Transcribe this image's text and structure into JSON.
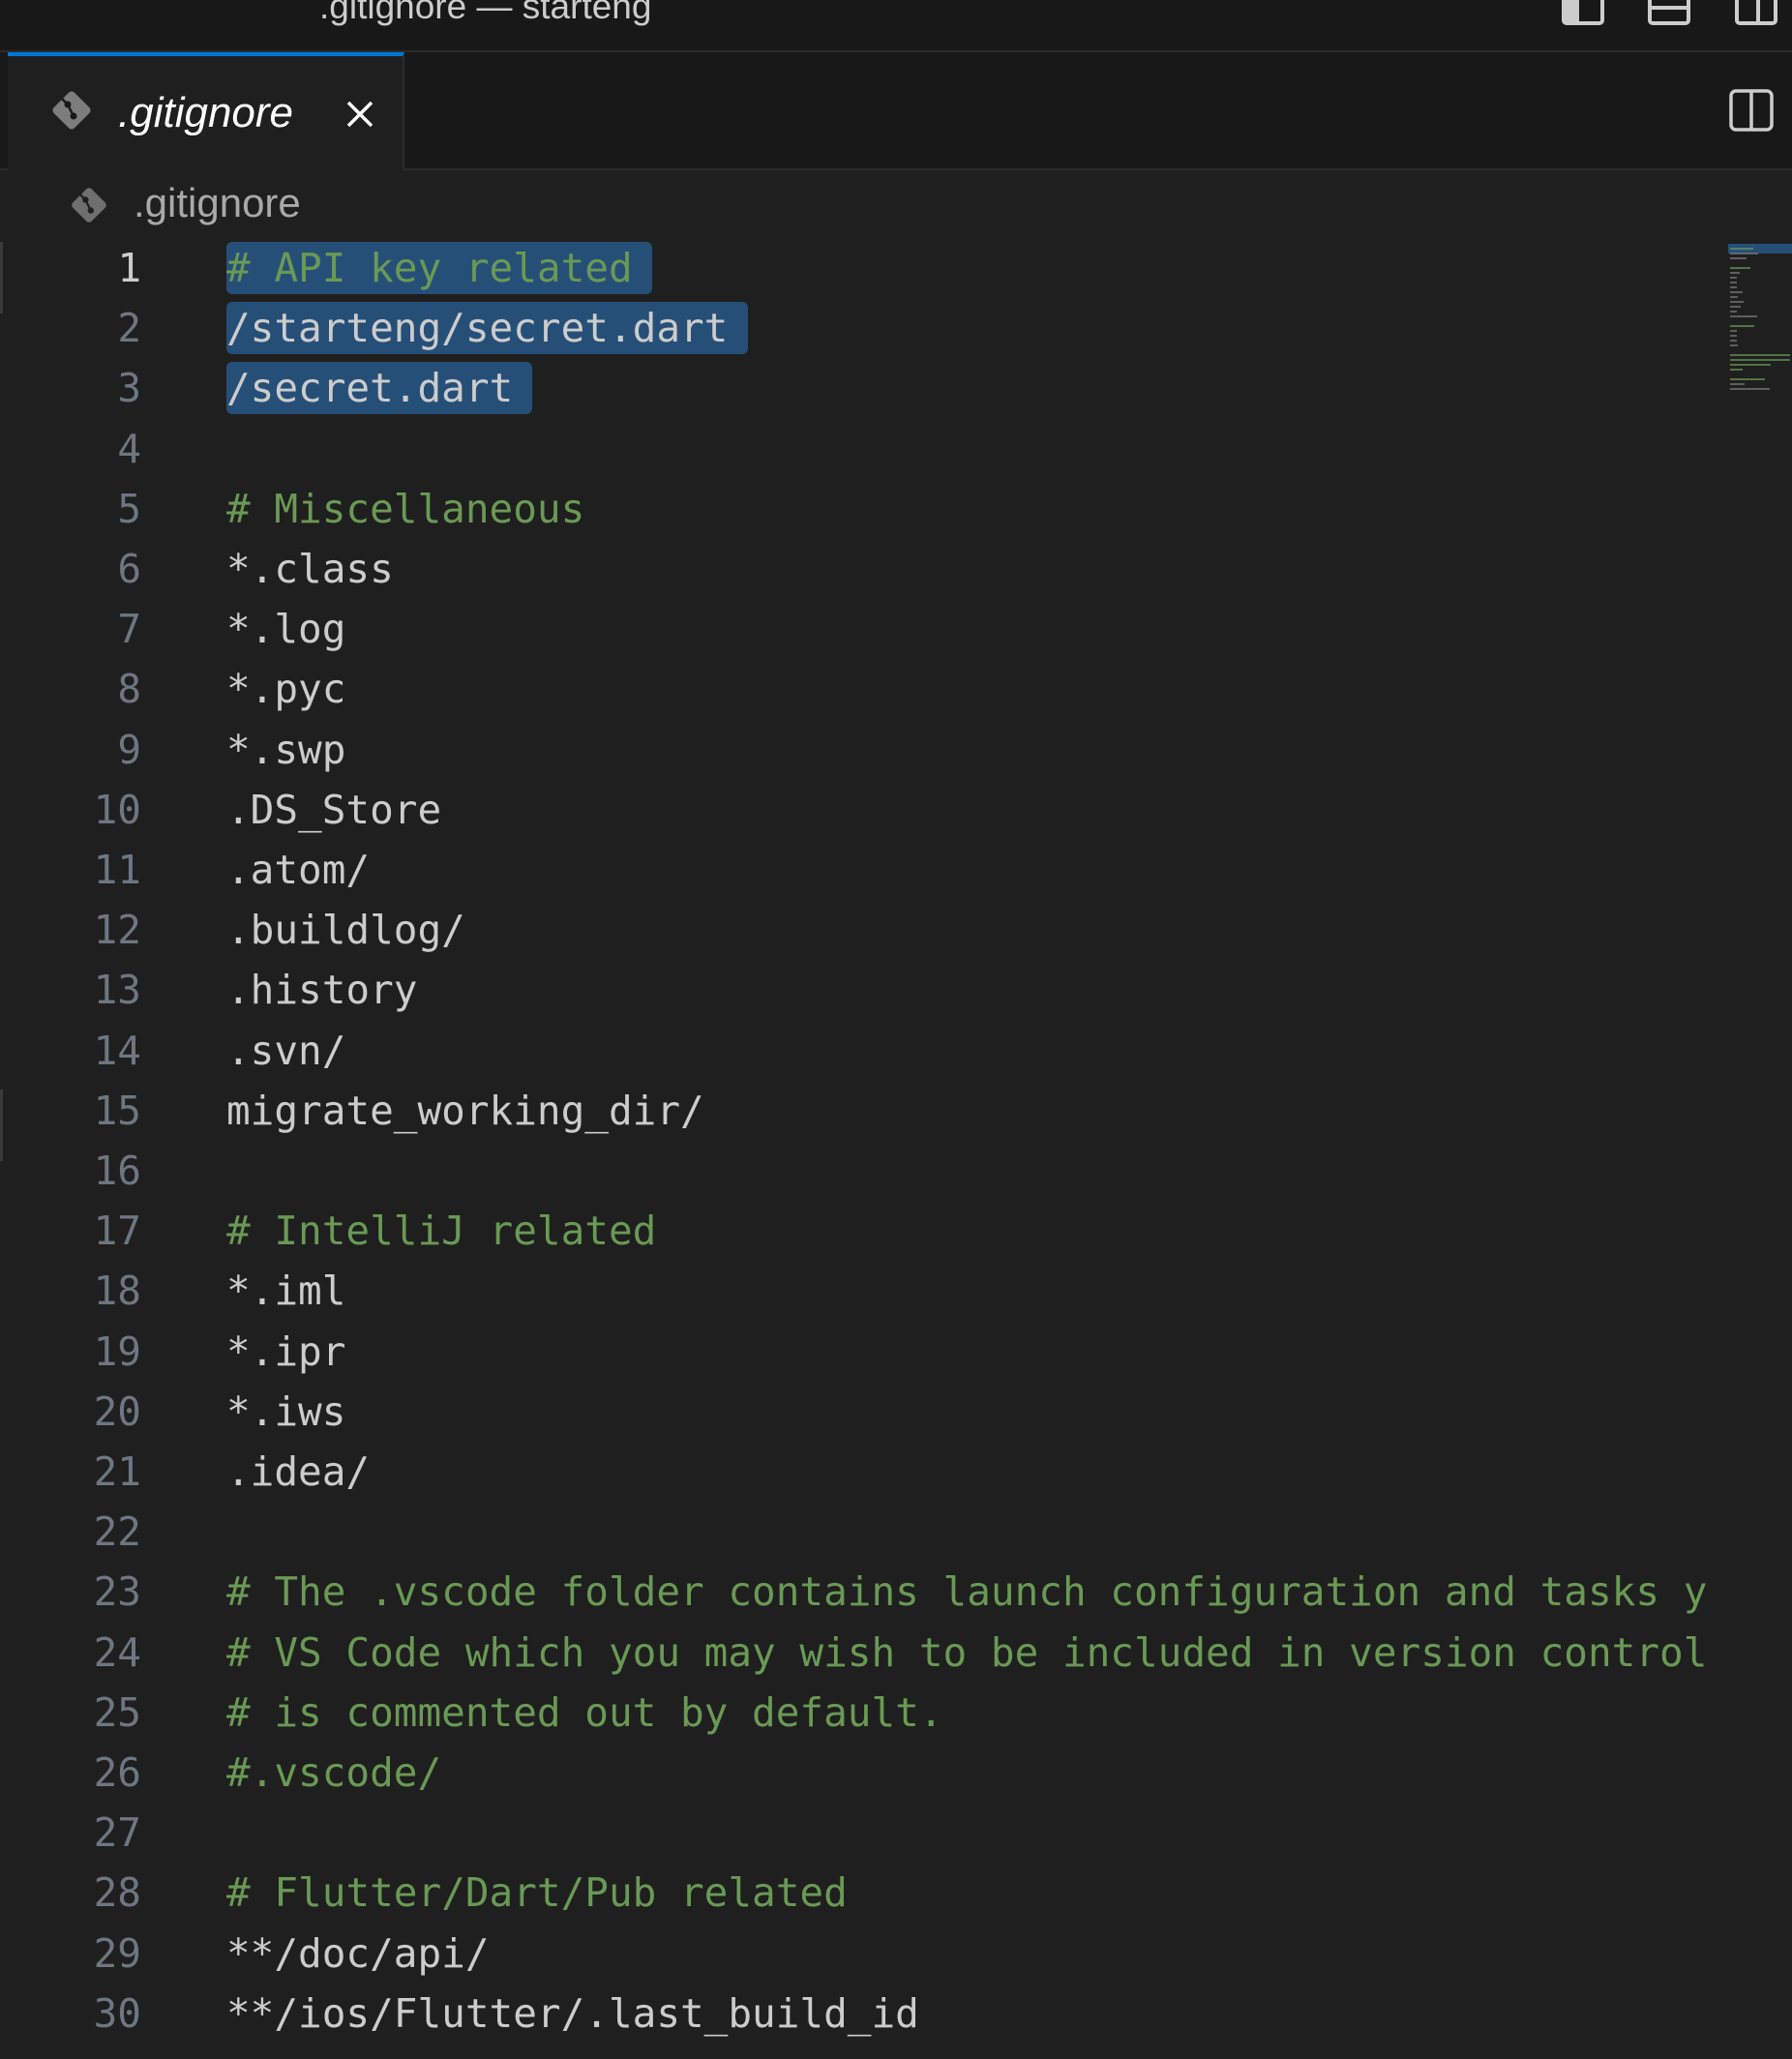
{
  "window": {
    "title": ".gitignore — starteng"
  },
  "layout_controls": [
    {
      "icon": "toggle-primary-sidebar-icon"
    },
    {
      "icon": "toggle-panel-icon"
    },
    {
      "icon": "toggle-secondary-sidebar-icon"
    }
  ],
  "tab": {
    "label": ".gitignore",
    "icon": "git-icon",
    "close_icon": "close-icon",
    "split_icon": "split-editor-icon"
  },
  "breadcrumb": {
    "label": ".gitignore",
    "icon": "git-icon"
  },
  "editor": {
    "lines": [
      {
        "n": "1",
        "text": "# API key related",
        "comment": true,
        "selected": true
      },
      {
        "n": "2",
        "text": "/starteng/secret.dart",
        "comment": false,
        "selected": true
      },
      {
        "n": "3",
        "text": "/secret.dart",
        "comment": false,
        "selected": true
      },
      {
        "n": "4",
        "text": "",
        "comment": false
      },
      {
        "n": "5",
        "text": "# Miscellaneous",
        "comment": true
      },
      {
        "n": "6",
        "text": "*.class",
        "comment": false
      },
      {
        "n": "7",
        "text": "*.log",
        "comment": false
      },
      {
        "n": "8",
        "text": "*.pyc",
        "comment": false
      },
      {
        "n": "9",
        "text": "*.swp",
        "comment": false
      },
      {
        "n": "10",
        "text": ".DS_Store",
        "comment": false
      },
      {
        "n": "11",
        "text": ".atom/",
        "comment": false
      },
      {
        "n": "12",
        "text": ".buildlog/",
        "comment": false
      },
      {
        "n": "13",
        "text": ".history",
        "comment": false
      },
      {
        "n": "14",
        "text": ".svn/",
        "comment": false
      },
      {
        "n": "15",
        "text": "migrate_working_dir/",
        "comment": false
      },
      {
        "n": "16",
        "text": "",
        "comment": false
      },
      {
        "n": "17",
        "text": "# IntelliJ related",
        "comment": true
      },
      {
        "n": "18",
        "text": "*.iml",
        "comment": false
      },
      {
        "n": "19",
        "text": "*.ipr",
        "comment": false
      },
      {
        "n": "20",
        "text": "*.iws",
        "comment": false
      },
      {
        "n": "21",
        "text": ".idea/",
        "comment": false
      },
      {
        "n": "22",
        "text": "",
        "comment": false
      },
      {
        "n": "23",
        "text": "# The .vscode folder contains launch configuration and tasks y",
        "comment": true
      },
      {
        "n": "24",
        "text": "# VS Code which you may wish to be included in version control",
        "comment": true
      },
      {
        "n": "25",
        "text": "# is commented out by default.",
        "comment": true
      },
      {
        "n": "26",
        "text": "#.vscode/",
        "comment": true
      },
      {
        "n": "27",
        "text": "",
        "comment": false
      },
      {
        "n": "28",
        "text": "# Flutter/Dart/Pub related",
        "comment": true
      },
      {
        "n": "29",
        "text": "**/doc/api/",
        "comment": false
      },
      {
        "n": "30",
        "text": "**/ios/Flutter/.last_build_id",
        "comment": false
      }
    ]
  },
  "colors": {
    "background": "#1f1f1f",
    "chrome": "#181818",
    "accent": "#0078d4",
    "selection": "#264f78",
    "comment": "#6a9955",
    "text": "#cccccc",
    "line_number": "#6e7681"
  }
}
